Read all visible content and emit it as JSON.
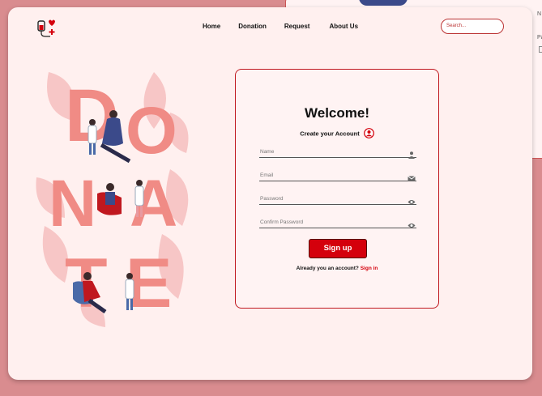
{
  "app": {
    "brand_color": "#d4000c"
  },
  "nav": {
    "items": [
      "Home",
      "Donation",
      "Request",
      "About Us"
    ],
    "search_placeholder": "Search..."
  },
  "illustration": {
    "letters": [
      "D",
      "O",
      "N",
      "A",
      "T",
      "E"
    ]
  },
  "form": {
    "title": "Welcome!",
    "subtitle": "Create your Account",
    "fields": [
      {
        "label": "Name",
        "icon": "user-icon"
      },
      {
        "label": "Email",
        "icon": "mail-icon"
      },
      {
        "label": "Password",
        "icon": "eye-icon"
      },
      {
        "label": "Confirm Password",
        "icon": "eye-icon"
      }
    ],
    "submit_label": "Sign up",
    "already_text": "Already  you an account?",
    "signin_label": "Sign in"
  }
}
